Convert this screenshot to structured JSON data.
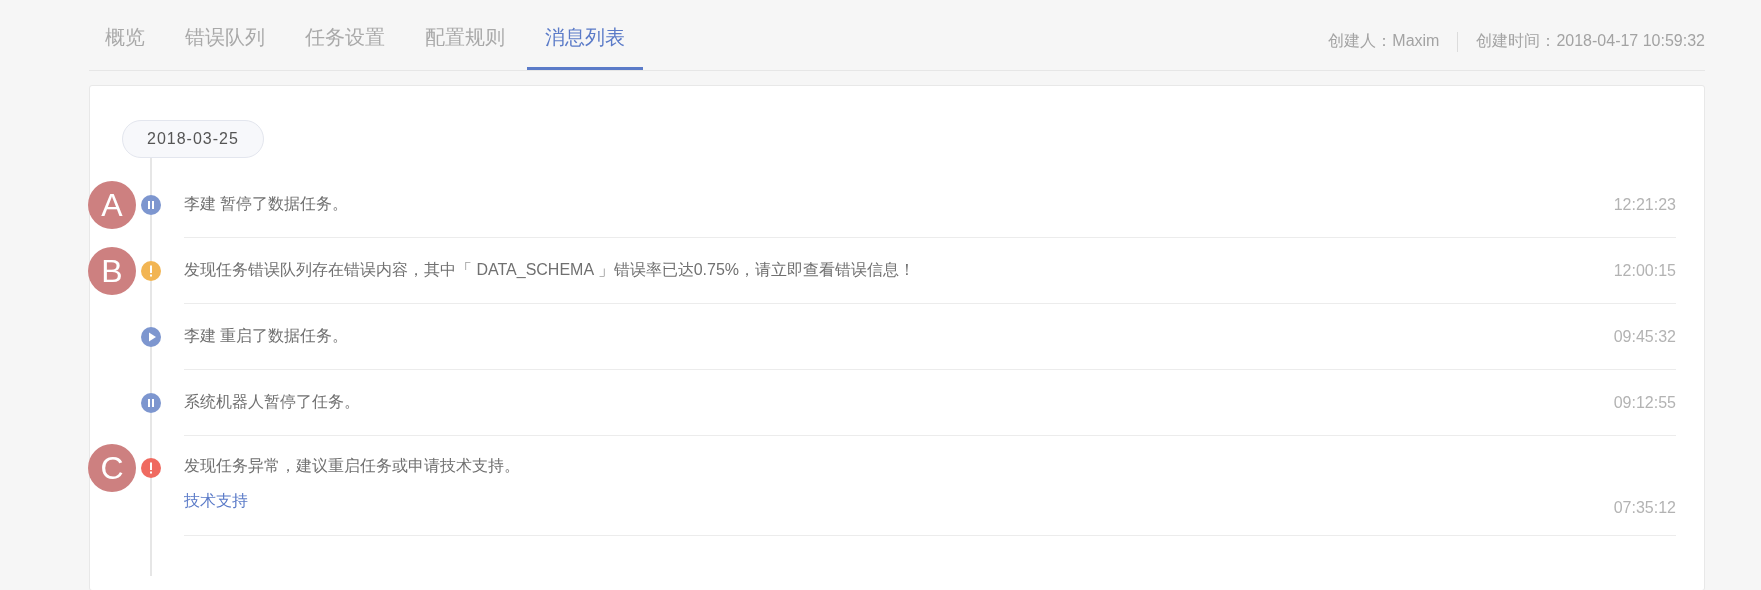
{
  "tabs": [
    {
      "label": "概览",
      "selected": false
    },
    {
      "label": "错误队列",
      "selected": false
    },
    {
      "label": "任务设置",
      "selected": false
    },
    {
      "label": "配置规则",
      "selected": false
    },
    {
      "label": "消息列表",
      "selected": true
    }
  ],
  "meta": {
    "creator_label": "创建人：",
    "creator": "Maxim",
    "created_label": "创建时间：",
    "created": "2018-04-17 10:59:32"
  },
  "date": "2018-03-25",
  "messages": [
    {
      "kind": "pause",
      "text": "李建 暂停了数据任务。",
      "time": "12:21:23",
      "annotation": "A"
    },
    {
      "kind": "warning",
      "text": "发现任务错误队列存在错误内容，其中「 DATA_SCHEMA 」错误率已达0.75%，请立即查看错误信息！",
      "time": "12:00:15",
      "annotation": "B"
    },
    {
      "kind": "play",
      "text": "李建 重启了数据任务。",
      "time": "09:45:32"
    },
    {
      "kind": "pause",
      "text": "系统机器人暂停了任务。",
      "time": "09:12:55"
    },
    {
      "kind": "error",
      "text": "发现任务异常，建议重启任务或申请技术支持。",
      "time": "07:35:12",
      "annotation": "C",
      "link": "技术支持"
    }
  ]
}
